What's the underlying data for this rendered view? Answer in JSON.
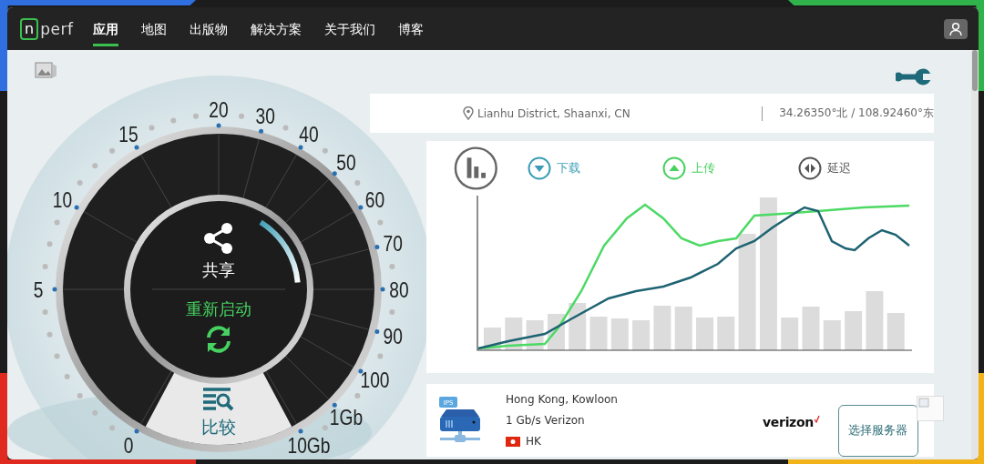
{
  "nav": {
    "logo": {
      "boxed": "n",
      "rest": "perf"
    },
    "items": [
      {
        "label": "应用",
        "selected": true
      },
      {
        "label": "地图",
        "selected": false
      },
      {
        "label": "出版物",
        "selected": false
      },
      {
        "label": "解决方案",
        "selected": false
      },
      {
        "label": "关于我们",
        "selected": false
      },
      {
        "label": "博客",
        "selected": false
      }
    ]
  },
  "gauge": {
    "scale": [
      "0",
      "5",
      "10",
      "15",
      "20",
      "30",
      "40",
      "50",
      "60",
      "70",
      "80",
      "90",
      "100",
      "1Gb",
      "10Gb"
    ],
    "share": "共享",
    "restart": "重新启动",
    "compare": "比较"
  },
  "location": {
    "place": "Lianhu District, Shaanxi, CN",
    "coords": "34.26350°北 / 108.92460°东"
  },
  "legend": [
    {
      "kind": "download",
      "label": "下载"
    },
    {
      "kind": "upload",
      "label": "上传"
    },
    {
      "kind": "latency",
      "label": "延迟"
    }
  ],
  "server": {
    "badge": "IPS",
    "city": "Hong Kong, Kowloon",
    "provider": "1 Gb/s Verizon",
    "country": "HK",
    "logo": "verizon",
    "button": "选择服务器"
  }
}
